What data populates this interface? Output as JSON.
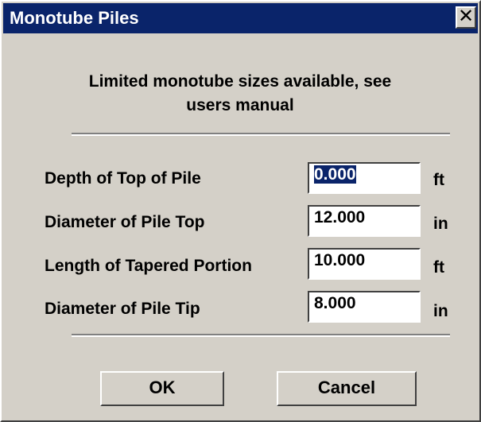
{
  "window": {
    "title": "Monotube Piles",
    "close_glyph": "✕",
    "titlebar_color": "#0a246a",
    "face_color": "#d4d0c8"
  },
  "message": {
    "line1": "Limited monotube sizes available, see",
    "line2": "users manual"
  },
  "fields": [
    {
      "label": "Depth of Top of Pile",
      "value": "0.000",
      "unit": "ft",
      "selected": true
    },
    {
      "label": "Diameter of Pile Top",
      "value": "12.000",
      "unit": "in",
      "selected": false
    },
    {
      "label": "Length of Tapered Portion",
      "value": "10.000",
      "unit": "ft",
      "selected": false
    },
    {
      "label": "Diameter of Pile Tip",
      "value": "8.000",
      "unit": "in",
      "selected": false
    }
  ],
  "buttons": {
    "ok_label": "OK",
    "cancel_label": "Cancel"
  }
}
